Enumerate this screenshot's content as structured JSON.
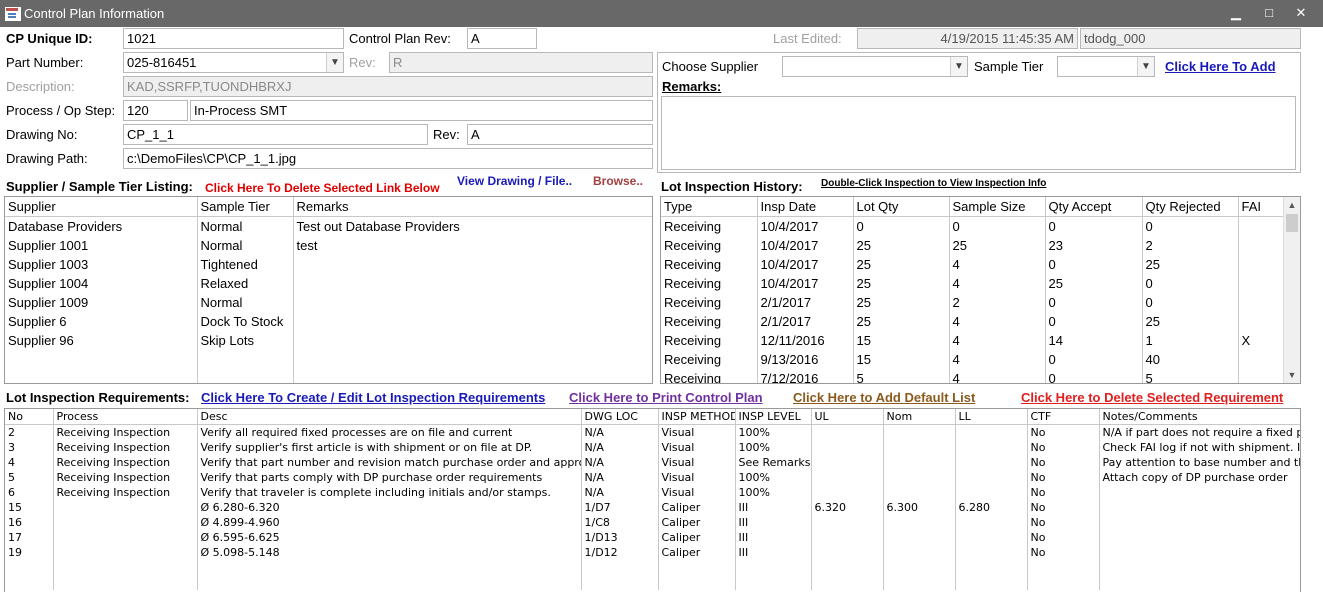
{
  "window": {
    "title": "Control Plan Information",
    "minimize": "▁",
    "maximize": "□",
    "close": "✕"
  },
  "form": {
    "cp_unique_id_label": "CP Unique ID:",
    "cp_unique_id": "1021",
    "control_plan_rev_label": "Control Plan Rev:",
    "control_plan_rev": "A",
    "last_edited_label": "Last Edited:",
    "last_edited_date": "4/19/2015 11:45:35 AM",
    "last_edited_user": "tdodg_000",
    "part_number_label": "Part Number:",
    "part_number": "025-816451",
    "rev_label": "Rev:",
    "rev": "R",
    "description_label": "Description:",
    "description": "KAD,SSRFP,TUONDHBRXJ",
    "process_label": "Process / Op Step:",
    "process_step": "120",
    "process_name": "In-Process SMT",
    "drawing_no_label": "Drawing No:",
    "drawing_no": "CP_1_1",
    "drawing_rev_label": "Rev:",
    "drawing_rev": "A",
    "drawing_path_label": "Drawing Path:",
    "drawing_path": "c:\\DemoFiles\\CP\\CP_1_1.jpg"
  },
  "supplier_panel": {
    "choose_supplier_label": "Choose Supplier",
    "choose_supplier_value": "",
    "sample_tier_label": "Sample Tier",
    "sample_tier_value": "",
    "add_link": "Click Here To Add",
    "remarks_label": "Remarks:"
  },
  "supplier_listing": {
    "title": "Supplier / Sample Tier Listing:",
    "delete_link": "Click Here To Delete Selected Link Below",
    "view_drawing_link": "View Drawing / File..",
    "browse_link": "Browse..",
    "columns": [
      "Supplier",
      "Sample Tier",
      "Remarks"
    ],
    "rows": [
      [
        "Database Providers",
        "Normal",
        "Test out Database Providers"
      ],
      [
        "Supplier 1001",
        "Normal",
        "test"
      ],
      [
        "Supplier 1003",
        "Tightened",
        ""
      ],
      [
        "Supplier 1004",
        "Relaxed",
        ""
      ],
      [
        "Supplier 1009",
        "Normal",
        ""
      ],
      [
        "Supplier 6",
        "Dock To Stock",
        ""
      ],
      [
        "Supplier 96",
        "Skip Lots",
        ""
      ]
    ]
  },
  "lot_history": {
    "title": "Lot Inspection History:",
    "hint_link": "Double-Click Inspection to View Inspection Info",
    "columns": [
      "Type",
      "Insp Date",
      "Lot Qty",
      "Sample Size",
      "Qty Accept",
      "Qty Rejected",
      "FAI"
    ],
    "rows": [
      [
        "Receiving",
        "10/4/2017",
        "0",
        "0",
        "0",
        "0",
        ""
      ],
      [
        "Receiving",
        "10/4/2017",
        "25",
        "25",
        "23",
        "2",
        ""
      ],
      [
        "Receiving",
        "10/4/2017",
        "25",
        "4",
        "0",
        "25",
        ""
      ],
      [
        "Receiving",
        "10/4/2017",
        "25",
        "4",
        "25",
        "0",
        ""
      ],
      [
        "Receiving",
        "2/1/2017",
        "25",
        "2",
        "0",
        "0",
        ""
      ],
      [
        "Receiving",
        "2/1/2017",
        "25",
        "4",
        "0",
        "25",
        ""
      ],
      [
        "Receiving",
        "12/11/2016",
        "15",
        "4",
        "14",
        "1",
        "X"
      ],
      [
        "Receiving",
        "9/13/2016",
        "15",
        "4",
        "0",
        "40",
        ""
      ],
      [
        "Receiving",
        "7/12/2016",
        "5",
        "4",
        "0",
        "5",
        ""
      ]
    ]
  },
  "requirements": {
    "title": "Lot Inspection Requirements:",
    "create_link": "Click Here To Create / Edit Lot Inspection Requirements",
    "print_link": "Click Here to Print Control Plan",
    "default_link": "Click Here to Add Default List",
    "delete_link": "Click Here to Delete Selected Requirement",
    "columns": [
      "No",
      "Process",
      "Desc",
      "DWG LOC",
      "INSP METHOD",
      "INSP LEVEL",
      "UL",
      "Nom",
      "LL",
      "CTF",
      "Notes/Comments"
    ],
    "rows": [
      [
        "2",
        "Receiving Inspection",
        "Verify all required fixed processes are on file and current",
        "N/A",
        "Visual",
        "100%",
        "",
        "",
        "",
        "No",
        "N/A if part does not require a fixed p"
      ],
      [
        "3",
        "Receiving Inspection",
        "Verify supplier's first article is with shipment or on file at DP.",
        "N/A",
        "Visual",
        "100%",
        "",
        "",
        "",
        "No",
        "Check FAI log if not with shipment.  I"
      ],
      [
        "4",
        "Receiving Inspection",
        "Verify that part number and revision match purchase order and approv",
        "N/A",
        "Visual",
        "See Remarks",
        "",
        "",
        "",
        "No",
        "Pay attention to base number and th"
      ],
      [
        "5",
        "Receiving Inspection",
        "Verify that parts comply with DP purchase order requirements",
        "N/A",
        "Visual",
        "100%",
        "",
        "",
        "",
        "No",
        "Attach copy of DP purchase order"
      ],
      [
        "6",
        "Receiving Inspection",
        "Verify that traveler is complete including initials and/or stamps.",
        "N/A",
        "Visual",
        "100%",
        "",
        "",
        "",
        "No",
        ""
      ],
      [
        "15",
        "",
        "Ø 6.280-6.320",
        "1/D7",
        "Caliper",
        "III",
        "6.320",
        "6.300",
        "6.280",
        "No",
        ""
      ],
      [
        "16",
        "",
        "Ø 4.899-4.960",
        "1/C8",
        "Caliper",
        "III",
        "",
        "",
        "",
        "No",
        ""
      ],
      [
        "17",
        "",
        "Ø 6.595-6.625",
        "1/D13",
        "Caliper",
        "III",
        "",
        "",
        "",
        "No",
        ""
      ],
      [
        "19",
        "",
        "Ø 5.098-5.148",
        "1/D12",
        "Caliper",
        "III",
        "",
        "",
        "",
        "No",
        ""
      ]
    ]
  }
}
